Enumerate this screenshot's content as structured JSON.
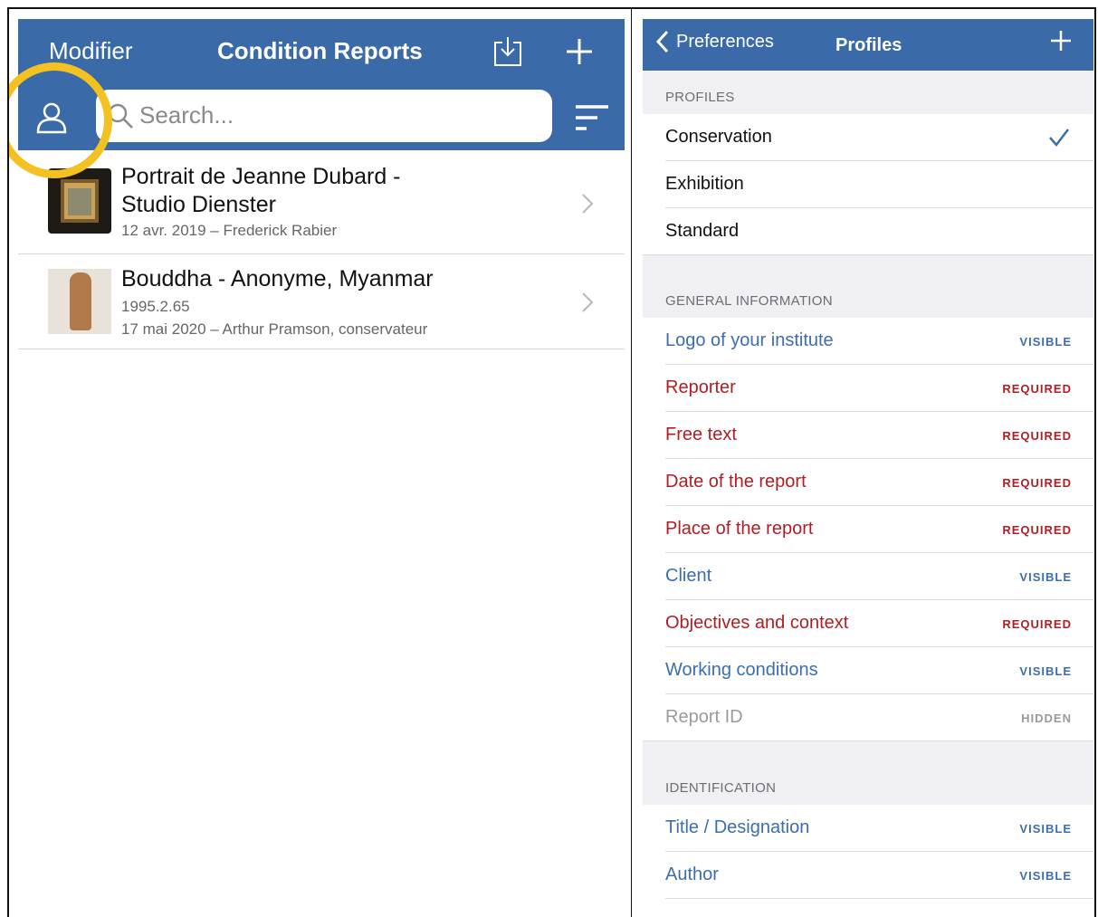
{
  "left": {
    "header": {
      "edit_label": "Modifier",
      "title": "Condition Reports",
      "icons": [
        "export-icon",
        "plus-icon",
        "profile-icon",
        "search-icon",
        "sort-icon",
        "chevron-right-icon"
      ]
    },
    "search": {
      "placeholder": "Search..."
    },
    "reports": [
      {
        "title_line1": "Portrait de Jeanne Dubard -",
        "title_line2": "Studio Dienster",
        "meta": "12 avr. 2019 – Frederick Rabier"
      },
      {
        "title_line1": "Bouddha  - Anonyme, Myanmar",
        "reference": "1995.2.65",
        "meta": "17 mai 2020 – Arthur Pramson, conservateur"
      }
    ]
  },
  "right": {
    "header": {
      "back_label": "Preferences",
      "title": "Profiles",
      "icons": [
        "chevron-left-icon",
        "plus-icon",
        "checkmark-icon"
      ]
    },
    "colors": {
      "visible": "#3b6db0",
      "required": "#b01e24",
      "hidden": "#9a9a9e",
      "nav": "#3a6ba8",
      "highlight_ring": "#f3c220"
    },
    "profiles_section": "PROFILES",
    "profiles": [
      {
        "name": "Conservation",
        "selected": true
      },
      {
        "name": "Exhibition",
        "selected": false
      },
      {
        "name": "Standard",
        "selected": false
      }
    ],
    "general_section": "GENERAL INFORMATION",
    "general_fields": [
      {
        "label": "Logo of your institute",
        "status": "VISIBLE"
      },
      {
        "label": "Reporter",
        "status": "REQUIRED"
      },
      {
        "label": "Free text",
        "status": "REQUIRED"
      },
      {
        "label": "Date of the report",
        "status": "REQUIRED"
      },
      {
        "label": "Place of the report",
        "status": "REQUIRED"
      },
      {
        "label": "Client",
        "status": "VISIBLE"
      },
      {
        "label": "Objectives and context",
        "status": "REQUIRED"
      },
      {
        "label": "Working conditions",
        "status": "VISIBLE"
      },
      {
        "label": "Report ID",
        "status": "HIDDEN"
      }
    ],
    "identification_section": "IDENTIFICATION",
    "identification_fields": [
      {
        "label": "Title / Designation",
        "status": "VISIBLE"
      },
      {
        "label": "Author",
        "status": "VISIBLE"
      }
    ]
  }
}
